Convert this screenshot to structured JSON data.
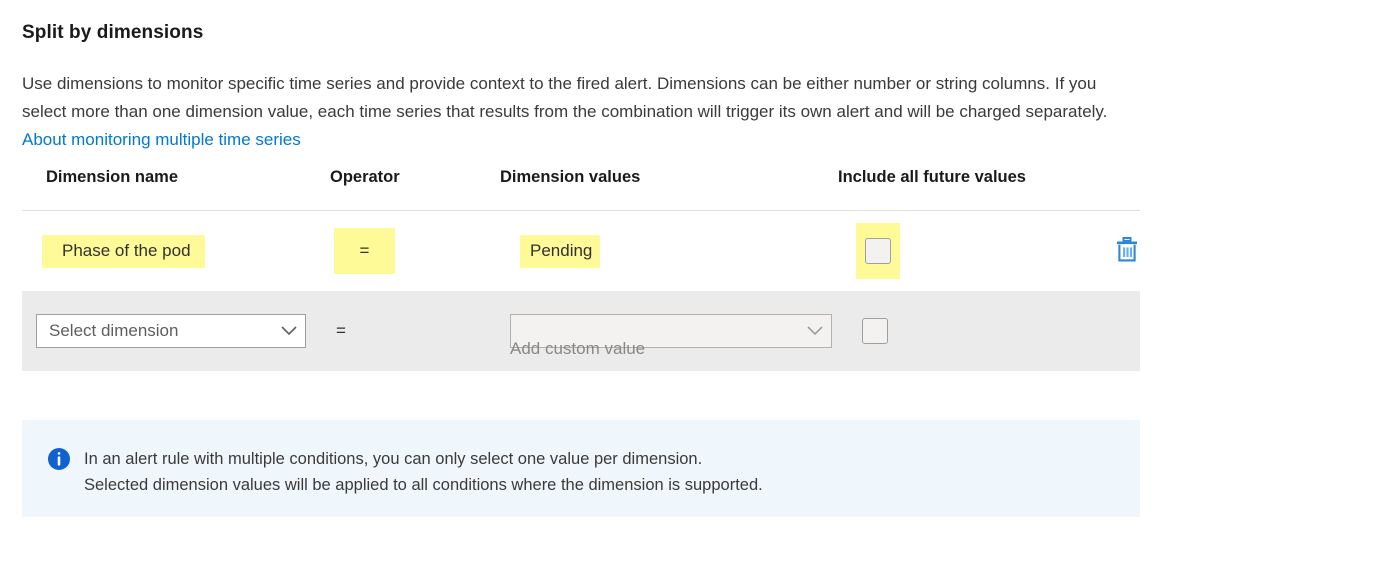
{
  "section": {
    "title": "Split by dimensions",
    "description_part1": "Use dimensions to monitor specific time series and provide context to the fired alert. Dimensions can be either number or string columns. If you select more than one dimension value, each time series that results from the combination will trigger its own alert and will be charged separately. ",
    "description_link": "About monitoring multiple time series"
  },
  "table": {
    "headers": {
      "dimension_name": "Dimension name",
      "operator": "Operator",
      "dimension_values": "Dimension values",
      "include_all_future_values": "Include all future values"
    },
    "existing_row": {
      "dimension_name": "Phase of the pod",
      "operator": "=",
      "dimension_values": "Pending",
      "include_future_checked": false,
      "delete_tooltip": "Delete"
    },
    "new_row": {
      "dimension_name_placeholder": "Select dimension",
      "operator": "=",
      "dimension_values_placeholder": "",
      "add_custom_value_hint": "Add custom value",
      "include_future_checked": false
    }
  },
  "info_banner": {
    "line1": "In an alert rule with multiple conditions, you can only select one value per dimension.",
    "line2": "Selected dimension values will be applied to all conditions where the dimension is supported."
  },
  "colors": {
    "accent_blue": "#0078d4",
    "highlight_yellow": "#fdfa97",
    "info_background": "#eff6fc",
    "new_row_background": "#ebebeb"
  }
}
